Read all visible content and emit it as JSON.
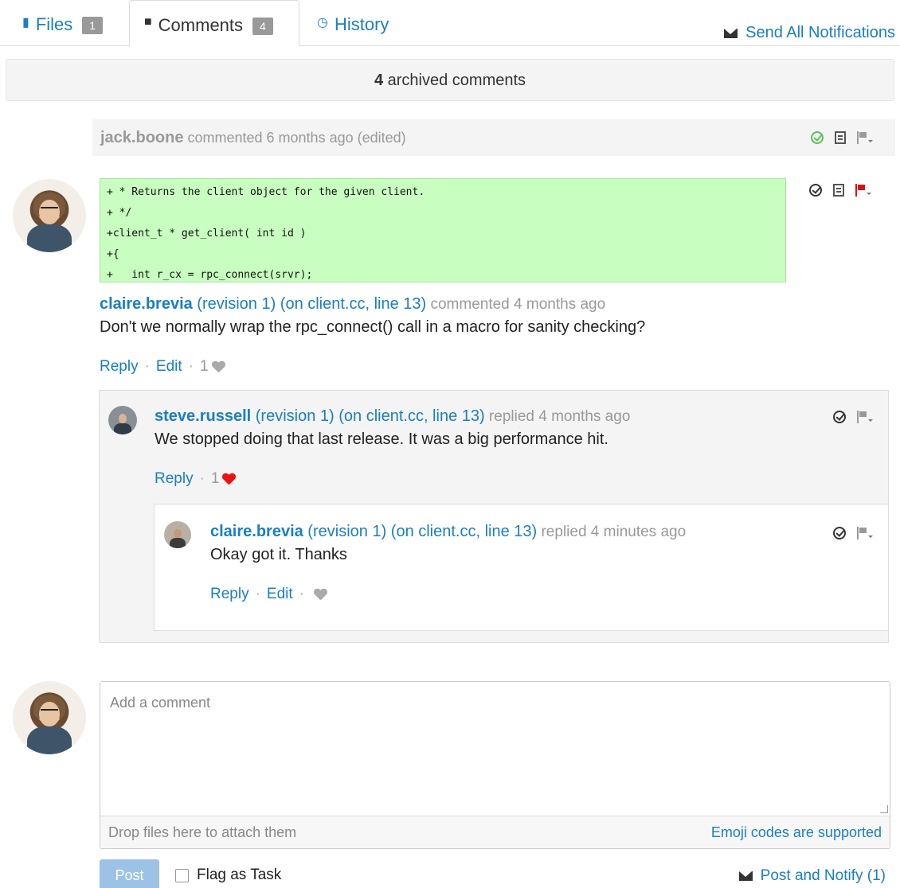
{
  "tabs": {
    "files": {
      "label": "Files",
      "count": "1"
    },
    "comments": {
      "label": "Comments",
      "count": "4"
    },
    "history": {
      "label": "History"
    }
  },
  "send_all": "Send All Notifications",
  "archived": {
    "count": "4",
    "text": " archived comments"
  },
  "archived_comment": {
    "user": "jack.boone",
    "meta": " commented 6 months ago (edited)"
  },
  "code": [
    "+ * Returns the client object for the given client.",
    "+ */",
    "+client_t * get_client( int id )",
    "+{",
    "+   int r_cx = rpc_connect(srvr);"
  ],
  "comment1": {
    "user": "claire.brevia",
    "context": " (revision 1) (on client.cc, line 13)",
    "meta": " commented 4 months ago",
    "body": "Don't we normally wrap the rpc_connect() call in a macro for sanity checking?",
    "reply": "Reply",
    "edit": "Edit",
    "likes": "1"
  },
  "reply1": {
    "user": "steve.russell",
    "context": " (revision 1) (on client.cc, line 13)",
    "meta": " replied 4 months ago",
    "body": "We stopped doing that last release. It was a big performance hit.",
    "reply": "Reply",
    "likes": "1"
  },
  "reply2": {
    "user": "claire.brevia",
    "context": " (revision 1) (on client.cc, line 13)",
    "meta": " replied 4 minutes ago",
    "body": "Okay got it. Thanks",
    "reply": "Reply",
    "edit": "Edit"
  },
  "composer": {
    "placeholder": "Add a comment",
    "drop_text": "Drop files here to attach them",
    "emoji_text": "Emoji codes are supported"
  },
  "post_label": "Post",
  "flag_task_label": "Flag as Task",
  "post_notify_label": "Post and Notify (1)",
  "colors": {
    "link": "#1a7ec3",
    "code_bg": "#c8ffc0",
    "flag_red": "#dd1111"
  }
}
